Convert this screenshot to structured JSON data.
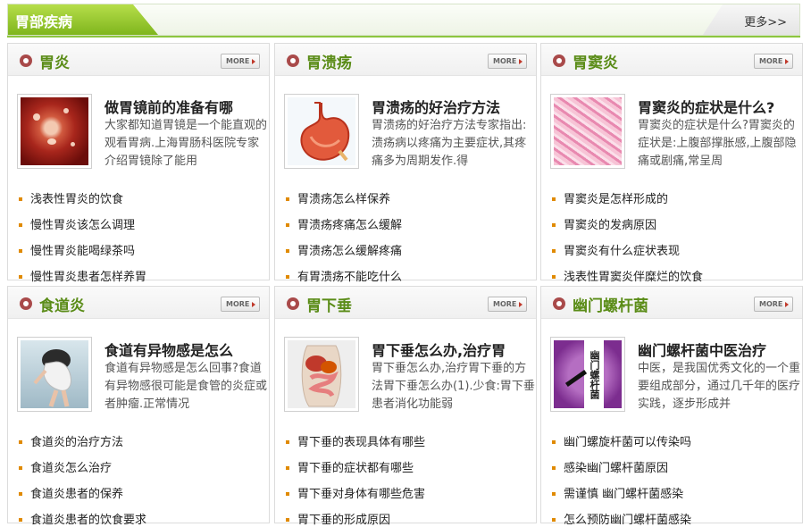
{
  "header": {
    "title": "胃部疾病",
    "more_label": "更多>>"
  },
  "panels": [
    {
      "title": "胃炎",
      "more_label": "MORE",
      "featured": {
        "title": "做胃镜前的准备有哪",
        "desc": "大家都知道胃镜是一个能直观的观看胃病.上海胃肠科医院专家介绍胃镜除了能用"
      },
      "items": [
        "浅表性胃炎的饮食",
        "慢性胃炎该怎么调理",
        "慢性胃炎能喝绿茶吗",
        "慢性胃炎患者怎样养胃"
      ]
    },
    {
      "title": "胃溃疡",
      "more_label": "MORE",
      "featured": {
        "title": "胃溃疡的好治疗方法",
        "desc": "胃溃疡的好治疗方法专家指出:溃疡病以疼痛为主要症状,其疼痛多为周期发作.得"
      },
      "items": [
        "胃溃疡怎么样保养",
        "胃溃疡疼痛怎么缓解",
        "胃溃疡怎么缓解疼痛",
        "有胃溃疡不能吃什么"
      ]
    },
    {
      "title": "胃窦炎",
      "more_label": "MORE",
      "featured": {
        "title": "胃窦炎的症状是什么?",
        "desc": "胃窦炎的症状是什么?胃窦炎的症状是:上腹部撑胀感,上腹部隐痛或剧痛,常呈周"
      },
      "items": [
        "胃窦炎是怎样形成的",
        "胃窦炎的发病原因",
        "胃窦炎有什么症状表现",
        "浅表性胃窦炎伴糜烂的饮食"
      ]
    },
    {
      "title": "食道炎",
      "more_label": "MORE",
      "featured": {
        "title": "食道有异物感是怎么",
        "desc": "食道有异物感是怎么回事?食道有异物感很可能是食管的炎症或者肿瘤.正常情况"
      },
      "items": [
        "食道炎的治疗方法",
        "食道炎怎么治疗",
        "食道炎患者的保养",
        "食道炎患者的饮食要求"
      ]
    },
    {
      "title": "胃下垂",
      "more_label": "MORE",
      "featured": {
        "title": "胃下垂怎么办,治疗胃",
        "desc": "胃下垂怎么办,治疗胃下垂的方法胃下垂怎么办(1).少食:胃下垂患者消化功能弱"
      },
      "items": [
        "胃下垂的表现具体有哪些",
        "胃下垂的症状都有哪些",
        "胃下垂对身体有哪些危害",
        "胃下垂的形成原因"
      ]
    },
    {
      "title": "幽门螺杆菌",
      "more_label": "MORE",
      "featured": {
        "title": "幽门螺杆菌中医治疗",
        "desc": "中医，是我国优秀文化的一个重要组成部分，通过几千年的医疗实践，逐步形成并"
      },
      "hp_image_text": "幽门螺杆菌",
      "items": [
        "幽门螺旋杆菌可以传染吗",
        "感染幽门螺杆菌原因",
        "需谨慎 幽门螺杆菌感染",
        "怎么预防幽门螺杆菌感染"
      ]
    }
  ]
}
